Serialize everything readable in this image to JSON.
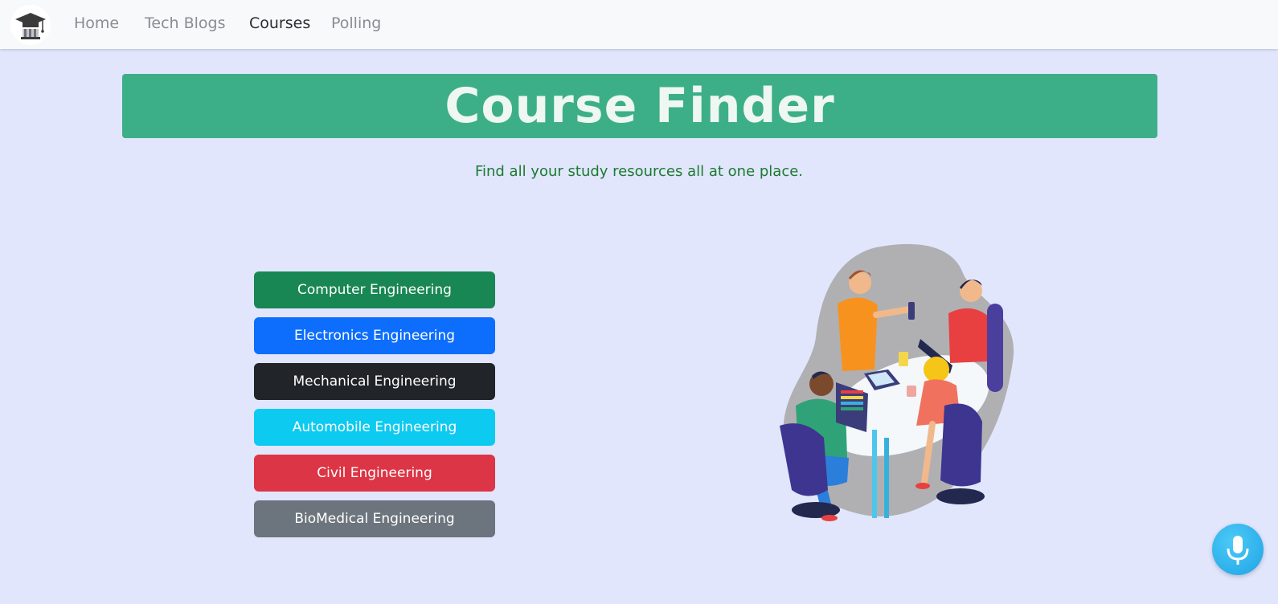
{
  "nav": {
    "links": [
      "Home",
      "Tech Blogs",
      "Courses",
      "Polling"
    ],
    "active": "Courses"
  },
  "hero": {
    "title": "Course Finder",
    "tagline": "Find all your study resources all at one place."
  },
  "courses": [
    {
      "label": "Computer Engineering",
      "color": "#198754"
    },
    {
      "label": "Electronics Engineering",
      "color": "#0d6efd"
    },
    {
      "label": "Mechanical Engineering",
      "color": "#212529"
    },
    {
      "label": "Automobile Engineering",
      "color": "#0dcaf0"
    },
    {
      "label": "Civil Engineering",
      "color": "#dc3545"
    },
    {
      "label": "BioMedical Engineering",
      "color": "#6c757d"
    }
  ],
  "icons": {
    "logo": "graduation-cap-logo-icon",
    "illustration": "students-studying-illustration",
    "voice": "microphone-icon"
  },
  "colors": {
    "background": "#e1e6fd",
    "banner": "#3daf88",
    "tagline": "#1c7a2f",
    "mic": "#1fa3e6"
  }
}
